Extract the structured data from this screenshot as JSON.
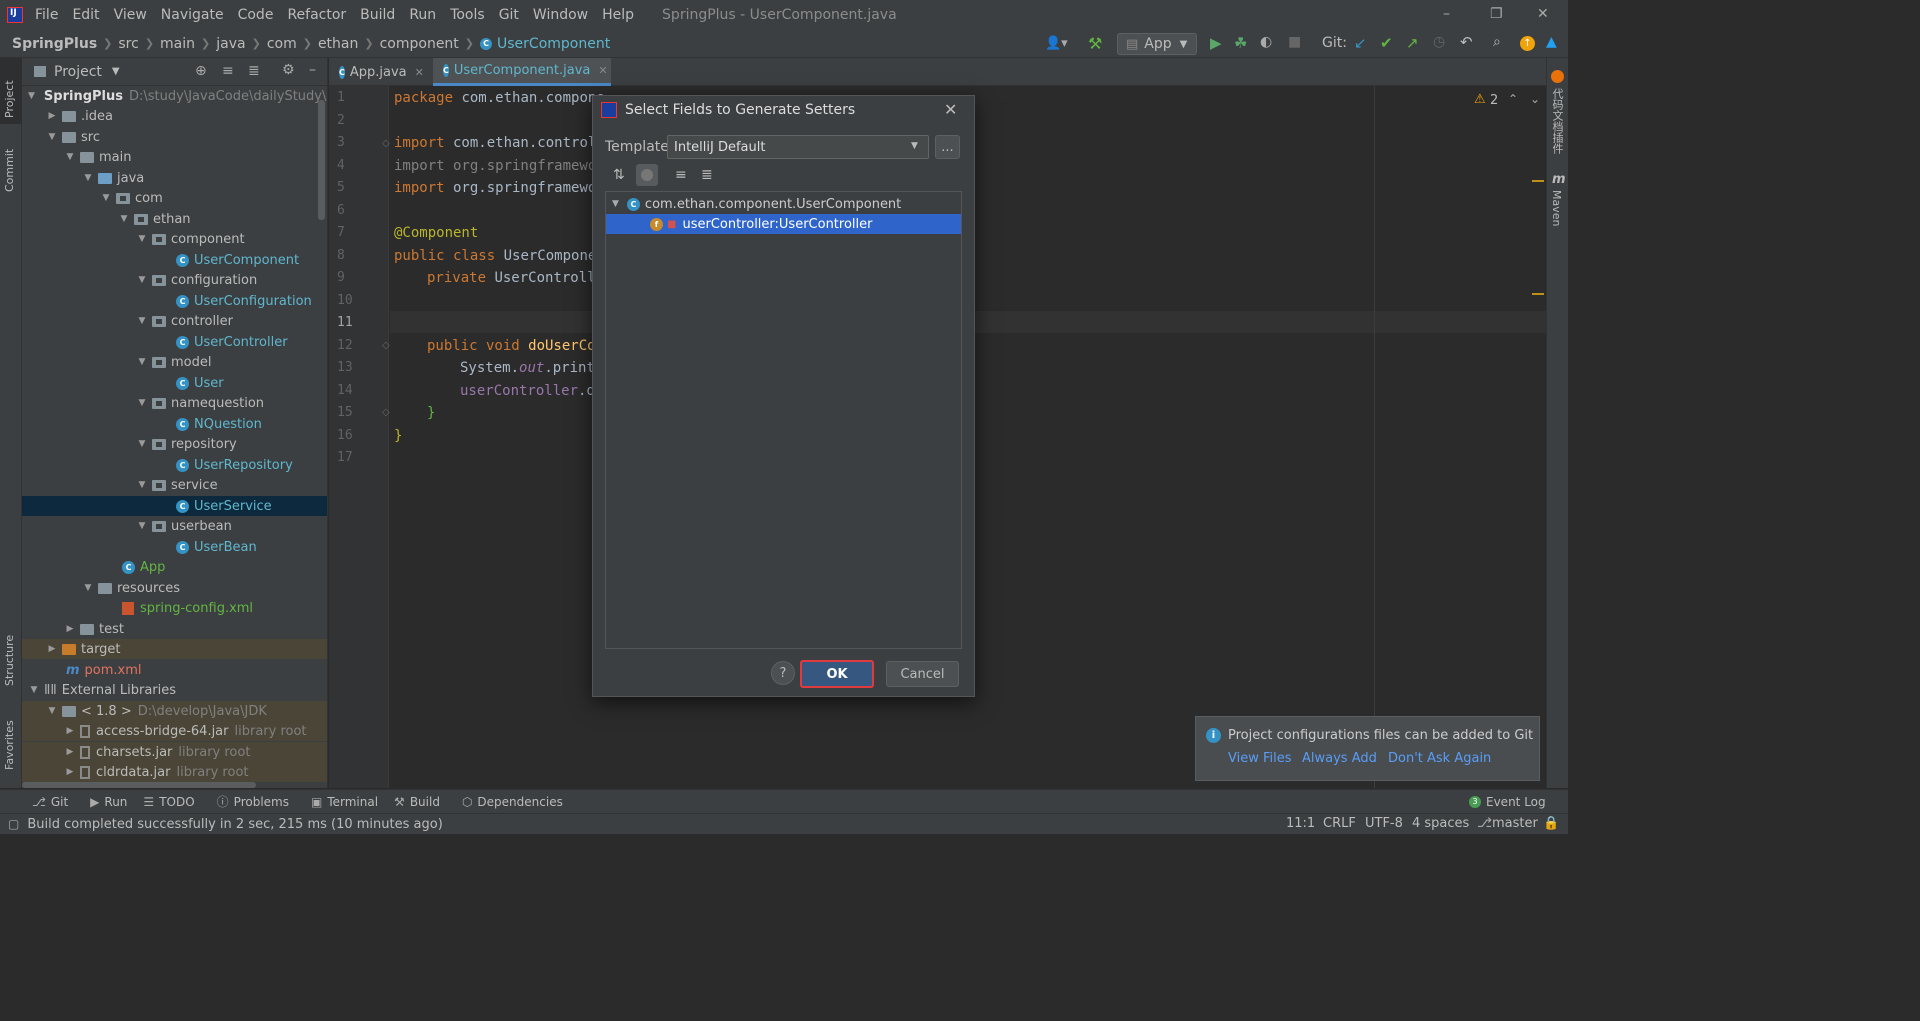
{
  "app": {
    "title": "SpringPlus - UserComponent.java",
    "menu": [
      "File",
      "Edit",
      "View",
      "Navigate",
      "Code",
      "Refactor",
      "Build",
      "Run",
      "Tools",
      "Git",
      "Window",
      "Help"
    ]
  },
  "breadcrumb": [
    "SpringPlus",
    "src",
    "main",
    "java",
    "com",
    "ethan",
    "component",
    "UserComponent"
  ],
  "toolbar": {
    "run_config": "App",
    "git_label": "Git:"
  },
  "project_panel": {
    "title": "Project",
    "root_name": "SpringPlus",
    "root_path": "D:\\study\\JavaCode\\dailyStudy\\S",
    "items": [
      {
        "label": ".idea"
      },
      {
        "label": "src"
      },
      {
        "label": "main"
      },
      {
        "label": "java"
      },
      {
        "label": "com"
      },
      {
        "label": "ethan"
      },
      {
        "label": "component"
      },
      {
        "label": "UserComponent"
      },
      {
        "label": "configuration"
      },
      {
        "label": "UserConfiguration"
      },
      {
        "label": "controller"
      },
      {
        "label": "UserController"
      },
      {
        "label": "model"
      },
      {
        "label": "User"
      },
      {
        "label": "namequestion"
      },
      {
        "label": "NQuestion"
      },
      {
        "label": "repository"
      },
      {
        "label": "UserRepository"
      },
      {
        "label": "service"
      },
      {
        "label": "UserService"
      },
      {
        "label": "userbean"
      },
      {
        "label": "UserBean"
      },
      {
        "label": "App"
      },
      {
        "label": "resources"
      },
      {
        "label": "spring-config.xml"
      },
      {
        "label": "test"
      },
      {
        "label": "target"
      },
      {
        "label": "pom.xml"
      },
      {
        "label": "External Libraries"
      },
      {
        "label": "< 1.8 >",
        "note": "D:\\develop\\Java\\JDK"
      },
      {
        "label": "access-bridge-64.jar",
        "note": "library root"
      },
      {
        "label": "charsets.jar",
        "note": "library root"
      },
      {
        "label": "cldrdata.jar",
        "note": "library root"
      }
    ]
  },
  "editor": {
    "tabs": [
      "App.java",
      "UserComponent.java"
    ],
    "line_numbers": [
      "1",
      "2",
      "3",
      "4",
      "5",
      "6",
      "7",
      "8",
      "9",
      "10",
      "11",
      "12",
      "13",
      "14",
      "15",
      "16",
      "17"
    ],
    "code": {
      "l1_kw": "package",
      "l1_rest": " com.ethan.compone",
      "l3_kw": "import",
      "l3_rest": " com.ethan.control",
      "l4": "import org.springframewor",
      "l5_kw": "import",
      "l5_rest": " org.springframewor",
      "l7": "@Component",
      "l8_kw": "public class",
      "l8_rest": " UserCompone",
      "l9_kw": "private",
      "l9_rest": " UserControlle",
      "l12_kw": "public void",
      "l12_fn": " doUserCo",
      "l13_a": "System.",
      "l13_b": "out",
      "l13_c": ".print",
      "l14_a": "userController",
      "l14_b": ".d",
      "l15": "}",
      "l16": "}"
    },
    "warnings": "2"
  },
  "right_strip": {
    "item1": "代码文档插件",
    "item2": "Maven"
  },
  "left_strip": {
    "project": "Project",
    "commit": "Commit",
    "structure": "Structure",
    "favorites": "Favorites"
  },
  "dialog": {
    "title": "Select Fields to Generate Setters",
    "template_label": "Template:",
    "template_value": "IntelliJ Default",
    "more_label": "...",
    "class_node": "com.ethan.component.UserComponent",
    "field_node": "userController:UserController",
    "help_label": "?",
    "ok_label": "OK",
    "cancel_label": "Cancel"
  },
  "notification": {
    "message": "Project configurations files can be added to Git",
    "actions": [
      "View Files",
      "Always Add",
      "Don't Ask Again"
    ]
  },
  "tool_windows": [
    "Git",
    "Run",
    "TODO",
    "Problems",
    "Terminal",
    "Build",
    "Dependencies"
  ],
  "event_log": {
    "count": "3",
    "label": "Event Log"
  },
  "status": {
    "message": "Build completed successfully in 2 sec, 215 ms (10 minutes ago)",
    "position": "11:1",
    "line_sep": "CRLF",
    "encoding": "UTF-8",
    "indent": "4 spaces",
    "branch": "master"
  },
  "colors": {
    "accent": "#4a88c7",
    "selection": "#2f65ca",
    "ok_highlight": "#e0393e"
  }
}
